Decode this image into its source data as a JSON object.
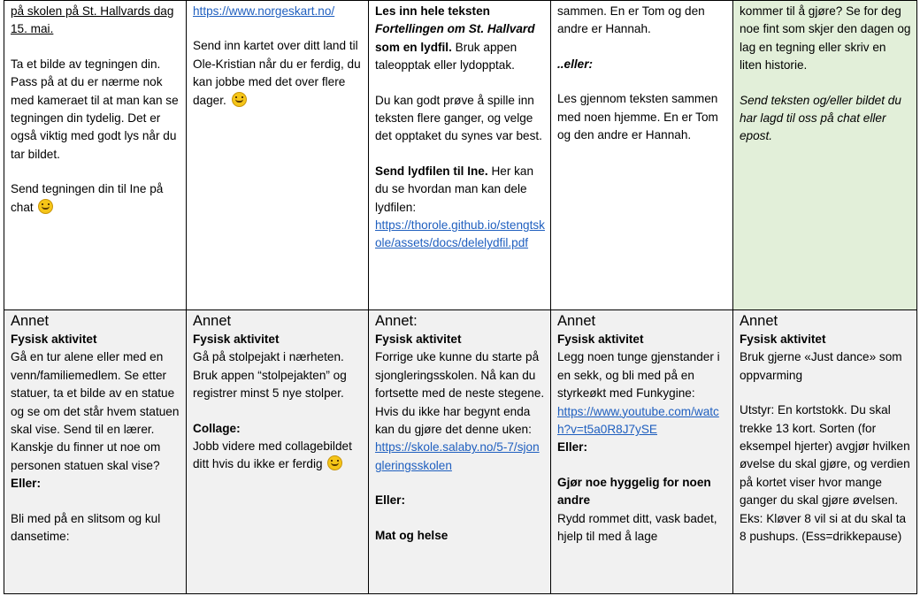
{
  "top": {
    "c1": {
      "p1": "på skolen på St. Hallvards dag 15. mai.",
      "p2": "Ta et bilde av tegningen din. Pass på at du er nærme nok med kameraet til at man kan se tegningen din tydelig. Det er også viktig med godt lys når du tar bildet.",
      "p3": "Send tegningen din til Ine på chat"
    },
    "c2": {
      "link": "https://www.norgeskart.no/",
      "p1": "Send inn kartet over ditt land til Ole-Kristian når du er ferdig, du kan jobbe med det over flere dager."
    },
    "c3": {
      "p1_a": "Les inn hele teksten",
      "p1_b": "Fortellingen om St. Hallvard",
      "p1_c": "som en lydfil.",
      "p1_d": "Bruk appen taleopptak eller lydopptak.",
      "p2": "Du kan godt prøve å spille inn teksten flere ganger, og velge det opptaket du synes var best.",
      "p3_a": "Send lydfilen til Ine.",
      "p3_b": "Her kan du se hvordan man kan dele lydfilen:",
      "link": "https://thorole.github.io/stengtskole/assets/docs/delelydfil.pdf"
    },
    "c4": {
      "p1": "sammen. En er Tom og den andre er Hannah.",
      "p2": "..eller:",
      "p3": "Les gjennom teksten sammen med noen hjemme. En er Tom og den andre er Hannah."
    },
    "c5": {
      "p1": "kommer til å gjøre? Se for deg noe fint som skjer den dagen og lag en tegning eller skriv en liten historie.",
      "p2": "Send teksten og/eller bildet du har lagd til oss på chat eller epost."
    }
  },
  "bottom": {
    "c1": {
      "heading": "Annet",
      "sub": "Fysisk aktivitet",
      "p1": "Gå en tur alene eller med en venn/familiemedlem. Se etter statuer, ta et bilde av en statue og se om det står hvem statuen skal vise. Send til en lærer. Kanskje du finner ut noe om personen statuen skal vise?",
      "eller": "Eller:",
      "p2": "Bli med på en slitsom og kul dansetime:"
    },
    "c2": {
      "heading": "Annet",
      "sub": "Fysisk aktivitet",
      "p1": "Gå på stolpejakt i nærheten. Bruk appen “stolpejakten” og registrer minst 5 nye stolper.",
      "sub2": "Collage:",
      "p2": "Jobb videre med collagebildet ditt hvis du ikke er ferdig"
    },
    "c3": {
      "heading": "Annet:",
      "sub": "Fysisk aktivitet",
      "p1": "Forrige uke kunne du starte på sjongleringsskolen. Nå kan du fortsette med de neste stegene. Hvis du ikke har begynt enda kan du gjøre det denne uken:",
      "link": "https://skole.salaby.no/5-7/sjongleringsskolen",
      "eller": "Eller:",
      "sub2": "Mat og helse"
    },
    "c4": {
      "heading": "Annet",
      "sub": "Fysisk aktivitet",
      "p1": "Legg noen tunge gjenstander i en sekk, og bli med på en styrkeøkt med Funkygine:",
      "link": "https://www.youtube.com/watch?v=t5a0R8J7ySE",
      "eller": "Eller:",
      "sub2": "Gjør noe hyggelig for noen andre",
      "p2": "Rydd rommet ditt, vask badet, hjelp til med å lage"
    },
    "c5": {
      "heading": "Annet",
      "sub": "Fysisk aktivitet",
      "p1": "Bruk gjerne «Just dance» som oppvarming",
      "p2": "Utstyr: En kortstokk. Du skal trekke 13 kort. Sorten (for eksempel hjerter) avgjør hvilken øvelse du skal gjøre, og verdien på kortet viser hvor mange ganger du skal gjøre øvelsen. Eks: Kløver 8 vil si at du skal ta 8 pushups. (Ess=drikkepause)"
    }
  },
  "colors": {
    "green_cell": "#e2efd9",
    "gray_row": "#f1f1f1",
    "link": "#1f5fbf"
  },
  "icons": [
    "smiley-icon"
  ]
}
